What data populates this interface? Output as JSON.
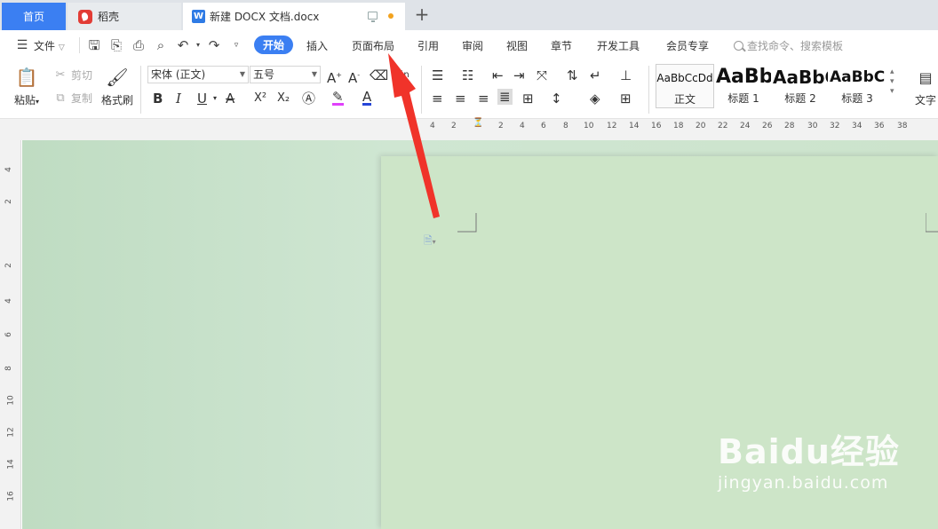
{
  "tabs": {
    "home": "首页",
    "daoke": "稻壳",
    "document": "新建 DOCX 文档.docx",
    "new_tab": "+"
  },
  "menu": {
    "file": "文件",
    "start": "开始",
    "insert": "插入",
    "page_layout": "页面布局",
    "references": "引用",
    "review": "审阅",
    "view": "视图",
    "chapter": "章节",
    "developer": "开发工具",
    "member": "会员专享",
    "search_placeholder": "查找命令、搜索模板"
  },
  "ribbon": {
    "paste": "粘贴",
    "cut": "剪切",
    "copy": "复制",
    "format_painter": "格式刷",
    "font_name": "宋体 (正文)",
    "font_size": "五号",
    "bold": "B",
    "italic": "I",
    "underline": "U",
    "superscript": "X²",
    "subscript": "X₂",
    "styles": [
      {
        "preview": "AaBbCcDd",
        "name": "正文"
      },
      {
        "preview": "AaBb",
        "name": "标题 1"
      },
      {
        "preview": "AaBbC",
        "name": "标题 2"
      },
      {
        "preview": "AaBbC",
        "name": "标题 3"
      }
    ],
    "text_tools": "文字"
  },
  "ruler": {
    "h_marks": [
      "4",
      "2",
      "2",
      "4",
      "6",
      "8",
      "10",
      "12",
      "14",
      "16",
      "18",
      "20",
      "22",
      "24",
      "26",
      "28",
      "30",
      "32",
      "34",
      "36",
      "38"
    ],
    "v_marks": [
      "4",
      "2",
      "2",
      "4",
      "6",
      "8",
      "10",
      "12",
      "14",
      "16"
    ]
  },
  "watermark": {
    "main": "Baidu经验",
    "sub": "jingyan.baidu.com"
  },
  "colors": {
    "accent": "#3b7ff2",
    "doc_bg": "#cde5c8",
    "arrow": "#f0332a",
    "highlight": "#e040fb",
    "font_color": "#2545d8"
  }
}
